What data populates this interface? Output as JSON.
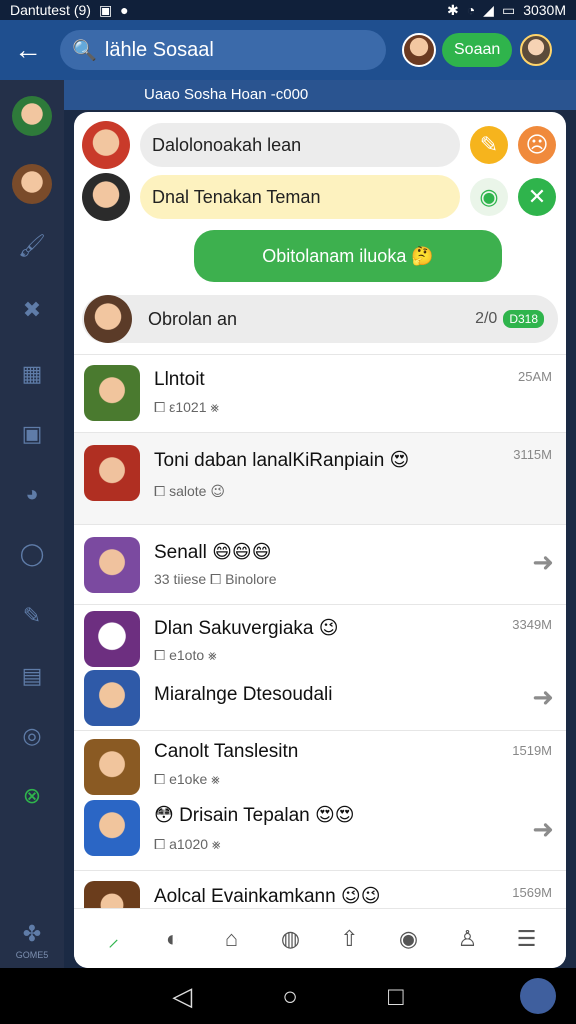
{
  "status": {
    "carrier": "Dantutest (9)",
    "time": "3030M"
  },
  "top": {
    "search_text": "lähle Sosaal",
    "action_label": "Soaan"
  },
  "banner": {
    "text": "Uaao Sosha Hoan -c000"
  },
  "sidebar": {
    "games_label": "GOME5"
  },
  "header_rows": [
    {
      "text": "Dalolonoakah lean"
    },
    {
      "text": "Dnal Tenakan Teman"
    }
  ],
  "bubble": {
    "text": "Obitolanam iluoka 🤔"
  },
  "convo_row": {
    "label": "Obrolan an",
    "tag_text": "2/0",
    "tag_green": "D318"
  },
  "list": [
    {
      "name": "Llntoit",
      "sub": "⧠ ε1021 ⨳",
      "time": "25AM",
      "arrow": false
    },
    {
      "name": "Toni daban lanalKiRanpiain 😍",
      "sub": "⧠ salote 😉",
      "time": "3115M",
      "arrow": false
    },
    {
      "name": "Senall 😄😄😄",
      "sub": "33 tiiese ⧠ Binolore",
      "time": "",
      "arrow": true
    },
    {
      "name": "Dlan Sakuvergiaka 😉",
      "sub": "⧠ e1oto ⨳",
      "time": "3349M",
      "arrow": false
    },
    {
      "name": "Miaralnge Dtesoudali",
      "sub": "",
      "time": "",
      "arrow": true
    },
    {
      "name": "Canolt Tanslesitn",
      "sub": "⧠ e1oke ⨳",
      "time": "1519M",
      "arrow": false
    },
    {
      "name": "😳 Drisain Tepalan 😍😍",
      "sub": "⧠ a1020 ⨳",
      "time": "",
      "arrow": true
    },
    {
      "name": "Aolcal Evainkamkann 😉😉",
      "sub": "",
      "time": "1569M",
      "arrow": false
    }
  ],
  "colors": {
    "accent": "#1f4f8f",
    "green": "#2fb44c",
    "yellow": "#f6b41d",
    "orange": "#f08a3c"
  }
}
